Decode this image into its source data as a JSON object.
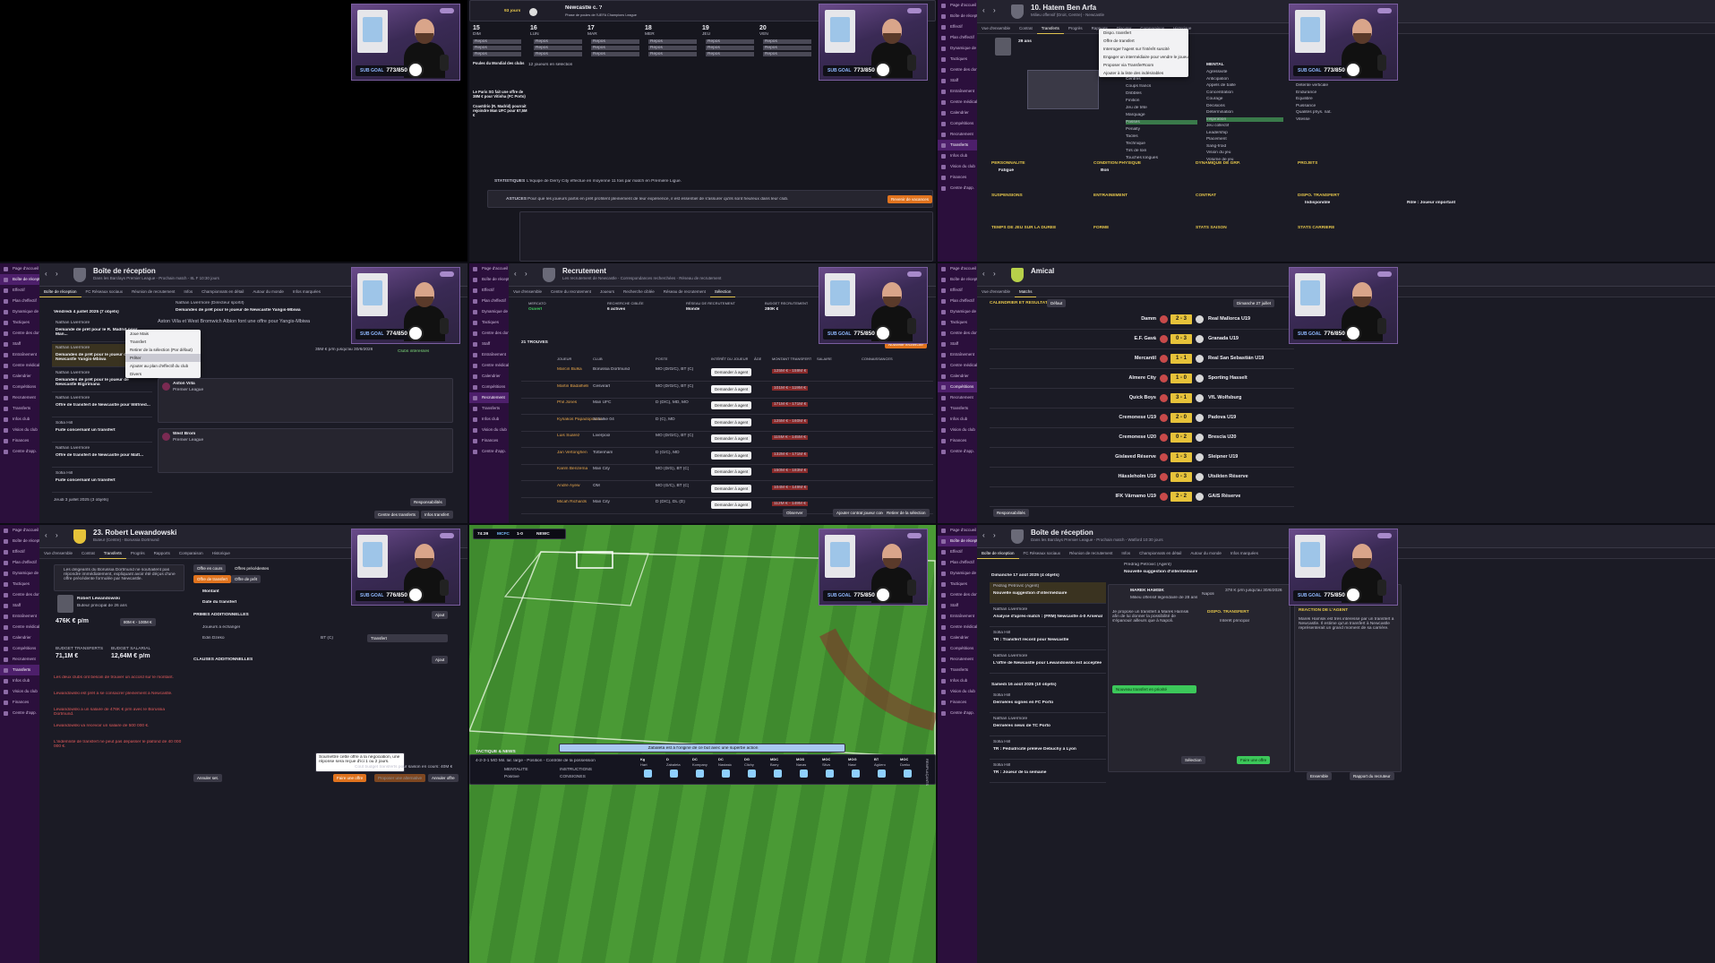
{
  "sidebar_items": [
    "Page d'accueil",
    "Boîte de réception",
    "Effectif",
    "Plan d'effectif",
    "Dynamique de grp.",
    "Tactiques",
    "Centre des données",
    "Staff",
    "Entraînement",
    "Centre médical",
    "Calendrier",
    "Compétitions",
    "Recrutement",
    "Transferts",
    "Infos club",
    "Vision du club",
    "Finances",
    "Centre d'app."
  ],
  "webcam_counters": [
    "773/850",
    "773/850",
    "773/850",
    "774/850",
    "775/850",
    "776/850",
    "776/850",
    "775/850",
    "775/850"
  ],
  "webcam_label": "SUB GOAL",
  "p1": {},
  "p2": {
    "days": "93 jours",
    "match_title": "Newcastle c. ?",
    "match_sub": "Phase de poules de l'UEFA Champions League",
    "calendar_days": [
      {
        "n": "15",
        "d": "DIM"
      },
      {
        "n": "16",
        "d": "LUN"
      },
      {
        "n": "17",
        "d": "MAR"
      },
      {
        "n": "18",
        "d": "MER"
      },
      {
        "n": "19",
        "d": "JEU"
      },
      {
        "n": "20",
        "d": "VEN"
      }
    ],
    "cell_label": "Repos",
    "news": [
      "Poules du Mondial des clubs",
      "12 joueurs en sélection",
      "Le Paris SG fait une offre de 38M € pour Vitinha (FC Porto)",
      "Coastdrio (R. Madrid) pourrait rejoindre Man UFC pour 67,5M €"
    ],
    "stat_label": "STATISTIQUES",
    "stat_text": "L'équipe de Derry City effectue en moyenne 11 fois par match en Première Ligue.",
    "advice_label": "ASTUCES",
    "advice_text": "Pour que les joueurs partis en prêt profitent pleinement de leur expérience, il est essentiel de s'assurer qu'ils sont heureux dans leur club.",
    "advice_button": "Revenir de vacances"
  },
  "p3": {
    "title": "10. Hatem Ben Arfa",
    "subtitle": "Milieu offensif (Droit, Centre) - Newcastle",
    "tabs": [
      "Vue d'ensemble",
      "Contrat",
      "Transferts",
      "Progrès",
      "Rapports",
      "Discuter",
      "Comparaison",
      "Historique"
    ],
    "menu": [
      "Dispo. transfert",
      "Offre de transfert",
      "Interroger l'agent sur l'intérêt suscité",
      "Engager un intermédiaire pour vendre le joueur",
      "Proposer via TransferRoom",
      "Ajouter à la liste des indésirables"
    ],
    "age": "29 ans",
    "sections": [
      "POSTES",
      "RÔLE ET TÂCHE",
      "MENTAL",
      "PHYSIQUE",
      "PERSONNALITÉ",
      "CONDITION PHYSIQUE",
      "DYNAMIQUE DE GRP.",
      "PROJETS",
      "SUSPENSIONS",
      "ENTRAÎNEMENT",
      "CONTRAT",
      "DISPO. TRANSFERT",
      "TEMPS DE JEU SUR LA DURÉE",
      "FORME",
      "STATS SAISON",
      "STATS CARRIÈRE"
    ],
    "attributes": [
      "Centres",
      "Coups francs",
      "Dribbles",
      "Finition",
      "Jeu de tête",
      "Marquage",
      "Passes",
      "Penalty",
      "Tacles",
      "Technique",
      "Tirs de loin",
      "Touches longues"
    ],
    "mental": [
      "Agressivité",
      "Anticipation",
      "Appels de balle",
      "Concentration",
      "Courage",
      "Décisions",
      "Détermination",
      "Inspiration",
      "Jeu collectif",
      "Leadership",
      "Placement",
      "Sang-froid",
      "Vision du jeu",
      "Volume de jeu"
    ],
    "physical": [
      "Accélération",
      "Agilité",
      "Détente verticale",
      "Endurance",
      "Équilibre",
      "Puissance",
      "Qualités phys. nat.",
      "Vitesse"
    ],
    "condition": "Fatigué",
    "group": "Bon",
    "transfer_dispo": "Indisponible",
    "playtime": "Rôle : Joueur important"
  },
  "p4": {
    "title": "Boîte de réception",
    "subtitle": "Dans les Barclays Premier League - Prochain match - 8L F 10:30 jours",
    "tabs": [
      "Boîte de réception",
      "FC Réseaux sociaux",
      "Réunion de recrutement",
      "Infos",
      "Championnats en détail",
      "Autour du monde",
      "Infos marquées"
    ],
    "date_header": "Vendredi 4 juillet 2025 (7 objets)",
    "messages": [
      {
        "from": "Nathan Livermore",
        "subject": "Demande de prêt pour le R. Madrid pour Man..."
      },
      {
        "from": "Nathan Livermore",
        "subject": "Demandes de prêt pour le joueur de Newcastle Yangis-Mbiwa"
      },
      {
        "from": "Nathan Livermore",
        "subject": "Demandes de prêt pour le joueur de Newcastle Bigirimana"
      },
      {
        "from": "Nathan Livermore",
        "subject": "Offre de transfert de Newcastle pour Wilfried..."
      },
      {
        "from": "Sofia Hill",
        "subject": "Fuite concernant un transfert"
      },
      {
        "from": "Nathan Livermore",
        "subject": "Offre de transfert de Newcastle pour Matt..."
      },
      {
        "from": "Sofia Hill",
        "subject": "Fuite concernant un transfert"
      }
    ],
    "date_header2": "Jeudi 3 juillet 2025 (3 objets)",
    "msg_title": "Demandes de prêt pour le joueur de Newcastle Yangis-Mbiwa",
    "msg_from": "Nathan Livermore (Directeur sportif)",
    "msg_body": "Aston Villa et West Bromwich Albion font une offre pour Yangis-Mbiwa",
    "menu": [
      "Joue Mais",
      "Transfert",
      "Retirer de la sélection (Par défaut)",
      "Prêter",
      "Ajouter au plan d'effectif du club",
      "Divers"
    ],
    "offers": [
      {
        "club": "Aston Villa",
        "league": "Premier League"
      },
      {
        "club": "West Brom",
        "league": "Premier League"
      }
    ],
    "salary": "35M € p/m jusqu'au 30/6/2026",
    "clauses": "Clubs intéressés",
    "buttons": [
      "Responsabilités",
      "Centre des transferts",
      "Infos transfert"
    ]
  },
  "p5": {
    "title": "Recrutement",
    "subtitle": "Les recrutement de Newcastle - Correspondances recherchées - Réseau de recrutement",
    "tabs": [
      "Vue d'ensemble",
      "Centre du recrutement",
      "Joueurs",
      "Recherche ciblée",
      "Réseau de recrutement",
      "Sélection"
    ],
    "summary": [
      {
        "k": "MERCATO",
        "v": "Ouvert"
      },
      {
        "k": "RECHERCHE CIBLÉE",
        "v": "6 actives"
      },
      {
        "k": "RÉSEAU DE RECRUTEMENT",
        "v": "Monde"
      },
      {
        "k": "BUDGET RECRUTEMENT",
        "v": "280K €"
      }
    ],
    "found": "21 TROUVÉS",
    "columns": [
      "JOUEUR",
      "CLUB",
      "POSTE",
      "INTÉRÊT DU JOUEUR",
      "ÂGE",
      "MONTANT TRANSFERT",
      "SALAIRE",
      "CONNAISSANCES"
    ],
    "players": [
      {
        "name": "Marcin Bulka",
        "club": "Borussia Dortmund",
        "pos": "MO (D/G/C), BT (C)",
        "price": "125M € - 159M €"
      },
      {
        "name": "Martin Badalhelli",
        "club": "Cesvirart",
        "pos": "MO (D/G/C), BT (C)",
        "price": "101M € - 119M €"
      },
      {
        "name": "Phil Jones",
        "club": "Man UFC",
        "pos": "D (D/C), MD, MO",
        "price": "171M € - 171M €"
      },
      {
        "name": "Kyriakos Papadopoulos",
        "club": "Schalke 04",
        "pos": "D (C), MD",
        "price": "125M € - 160M €"
      },
      {
        "name": "Luis Suárez",
        "club": "Liverpool",
        "pos": "MO (D/G/C), BT (C)",
        "price": "115M € - 145M €"
      },
      {
        "name": "Jan Vertonghen",
        "club": "Tottenham",
        "pos": "D (G/C), MD",
        "price": "132M € - 171M €"
      },
      {
        "name": "Karim Benzema",
        "club": "Man City",
        "pos": "MO (D/G), BT (C)",
        "price": "150M € - 183M €"
      },
      {
        "name": "André Ayew",
        "club": "OM",
        "pos": "MO (G/C), BT (C)",
        "price": "104M € - 149M €"
      },
      {
        "name": "Micah Richards",
        "club": "Man City",
        "pos": "D (D/C), DL (D)",
        "price": "112M € - 149M €"
      }
    ],
    "action_button": "Demander à agent",
    "new_search": "Nouvelle recherche",
    "footer": [
      "Observer",
      "Ajouter contrat joueur concerné",
      "Retirer de la sélection"
    ]
  },
  "p6": {
    "title": "Amical",
    "tabs": [
      "Vue d'ensemble",
      "Matchs"
    ],
    "section": "CALENDRIER ET RÉSULTATS",
    "filter": "Défaut",
    "date_sel": "Dimanche 27 juillet",
    "matches": [
      {
        "home": "Damm",
        "score": "2 - 3",
        "away": "Real Mallorca U19"
      },
      {
        "home": "E.F. Gavà",
        "score": "0 - 3",
        "away": "Granada U19"
      },
      {
        "home": "Mercantil",
        "score": "1 - 1",
        "away": "Real San Sebastián U19"
      },
      {
        "home": "Almere City",
        "score": "1 - 0",
        "away": "Sporting Hasselt"
      },
      {
        "home": "Quick Boys",
        "score": "3 - 1",
        "away": "VfL Wolfsburg"
      },
      {
        "home": "Cremonese U19",
        "score": "2 - 0",
        "away": "Padova U19"
      },
      {
        "home": "Cremonese U20",
        "score": "0 - 2",
        "away": "Brescia U20"
      },
      {
        "home": "Gislaved Réserve",
        "score": "1 - 3",
        "away": "Sleipner U19"
      },
      {
        "home": "Hässleholm U19",
        "score": "0 - 3",
        "away": "Utsikten Réserve"
      },
      {
        "home": "IFK Värnamo U19",
        "score": "2 - 2",
        "away": "GAIS Réserve"
      }
    ],
    "footer": "Responsabilités"
  },
  "p7": {
    "title": "23. Robert Lewandowski",
    "subtitle": "Buteur (Centre) - Borussia Dortmund",
    "tabs": [
      "Vue d'ensemble",
      "Contrat",
      "Transferts",
      "Progrès",
      "Rapports",
      "Comparaison",
      "Historique"
    ],
    "warning": "Les dirigeants du Borussia Dortmund ne souhaitent pas répondre immédiatement, expliquant avoir été déçus d'une offre précédente formulée par Newcastle.",
    "player_name": "Robert Lewandowski",
    "player_desc": "Buteur principal de 26 ans",
    "offer_tabs": [
      "Offre en cours",
      "Offres précédentes"
    ],
    "offer_type": [
      "Offre de transfert",
      "Offre de prêt"
    ],
    "amount_label": "Montant",
    "date_label": "Date du transfert",
    "value": "476K € p/m",
    "range": "80M € - 100M €",
    "budget_label": "BUDGET TRANSFERTS",
    "budget": "71,1M €",
    "wage_label": "BUDGET SALARIAL",
    "wage": "12,64M € p/m",
    "primes": "PRIMES ADDITIONNELLES",
    "clauses": "CLAUSES ADDITIONNELLES",
    "swap_label": "Joueurs à échanger",
    "swap_player": "Edin Dzeko",
    "swap_value": "BT (C)",
    "swap_type": "Transfert",
    "add": "Ajout",
    "red_notes": [
      "Les deux clubs ont besoin de trouver un accord sur le montant.",
      "Lewandowski est prêt à se consacrer pleinement à Newcastle.",
      "Lewandowski a un salaire de 476K € p/m avec le Borussia Dortmund.",
      "Lewandowski va recevoir un salaire de 500 000 €.",
      "L'indemnité de transfert ne peut pas dépasser le plafond de 40 000 000 €."
    ],
    "tooltip": "Soumettre cette offre à la négociation, une réponse sera reçue d'ici 1 ou 2 jours.",
    "budget_left": "Coût budget transferts pour saison en cours: 40M €",
    "buttons": [
      "Annuler set.",
      "Faire une offre",
      "Proposer une alternative",
      "Annuler offre"
    ]
  },
  "p8": {
    "clock": "74:39",
    "home": "MCFC",
    "score": "1-0",
    "away": "NEWC",
    "commentary": "Zabaleta est à l'origine de ce but avec une superbe action",
    "formation": "4-2-3-1 MO Mil. lar. large - Position - Contrôle de la possession",
    "player_strip": [
      "Kg",
      "D",
      "DC",
      "DC",
      "DG",
      "MDC",
      "MOD",
      "MOC",
      "MOG",
      "BT",
      "MOC"
    ],
    "player_names": [
      "Hart",
      "Zabaleta",
      "Kompany",
      "Nastasic",
      "Clichy",
      "Barry",
      "Navas",
      "Silva",
      "Nasri",
      "Agüero",
      "Dzeko"
    ],
    "tactics_label": "TACTIQUE & NEWS",
    "side_label": "REMPLAÇANTS",
    "instr": [
      "MENTALITÉ",
      "INSTRUCTIONS",
      "CONSIGNES"
    ],
    "mentality": "Positive"
  },
  "p9": {
    "title": "Boîte de réception",
    "subtitle": "Dans les Barclays Premier League - Prochain match - Watford 10:30 jours",
    "tabs": [
      "Boîte de réception",
      "FC Réseaux sociaux",
      "Réunion de recrutement",
      "Infos",
      "Championnats en détail",
      "Autour du monde",
      "Infos marquées"
    ],
    "date_header": "Dimanche 17 août 2025 (4 objets)",
    "messages": [
      {
        "from": "Pedrag Petrović (Agent)",
        "subject": "Nouvelle suggestion d'intermédiaire"
      },
      {
        "from": "Nathan Livermore",
        "subject": "Analyse d'après-match : (FRM) Newcastle 4-0 Arsenal"
      },
      {
        "from": "Sofia Hill",
        "subject": "TR : Transfert record pour Newcastle"
      },
      {
        "from": "Nathan Livermore",
        "subject": "L'offre de Newcastle pour Lewandowski est acceptée"
      }
    ],
    "date_header2": "Samedi 16 août 2025 (10 objets)",
    "messages2": [
      {
        "from": "Sofia Hill",
        "subject": "Dernières signes en FC Porto"
      },
      {
        "from": "Nathan Livermore",
        "subject": "Dernières news de TC Porto"
      },
      {
        "from": "Sofia Hill",
        "subject": "TR : Pédiatricité prélève Debuchy à Lyon"
      },
      {
        "from": "Sofia Hill",
        "subject": "TR : Joueur de la semaine"
      }
    ],
    "msg_from": "Predrag Petrović (Agent)",
    "msg_title": "Nouvelle suggestion d'intermédiaire",
    "player": "MAREK HAMSIK",
    "player_desc": "Milieu offensif légendaire de 28 ans",
    "club": "Napoli",
    "salary": "378 K p/m jusqu'au 30/6/2026",
    "body": "Je propose un transfert à Marek Hamsik afin de lui donner la possibilité de s'épanouir ailleurs que à Napoli.",
    "button_reward": "Nouveau transfert en priorité",
    "dispo": "DISPO. TRANSFERT",
    "interest": "Intérêt principal",
    "role": "MILIEU OFFENSIF (CENTRE)",
    "reaction": "RÉACTION DE L'AGENT",
    "reaction_text": "Marek Hamsik est très intéressé par un transfert à Newcastle. Il estime qu'un transfert à Newcastle représenterait un grand moment de sa carrière.",
    "footer": [
      "Sélection",
      "Faire une offre",
      "Ensemble",
      "Rapport du recruteur"
    ]
  }
}
